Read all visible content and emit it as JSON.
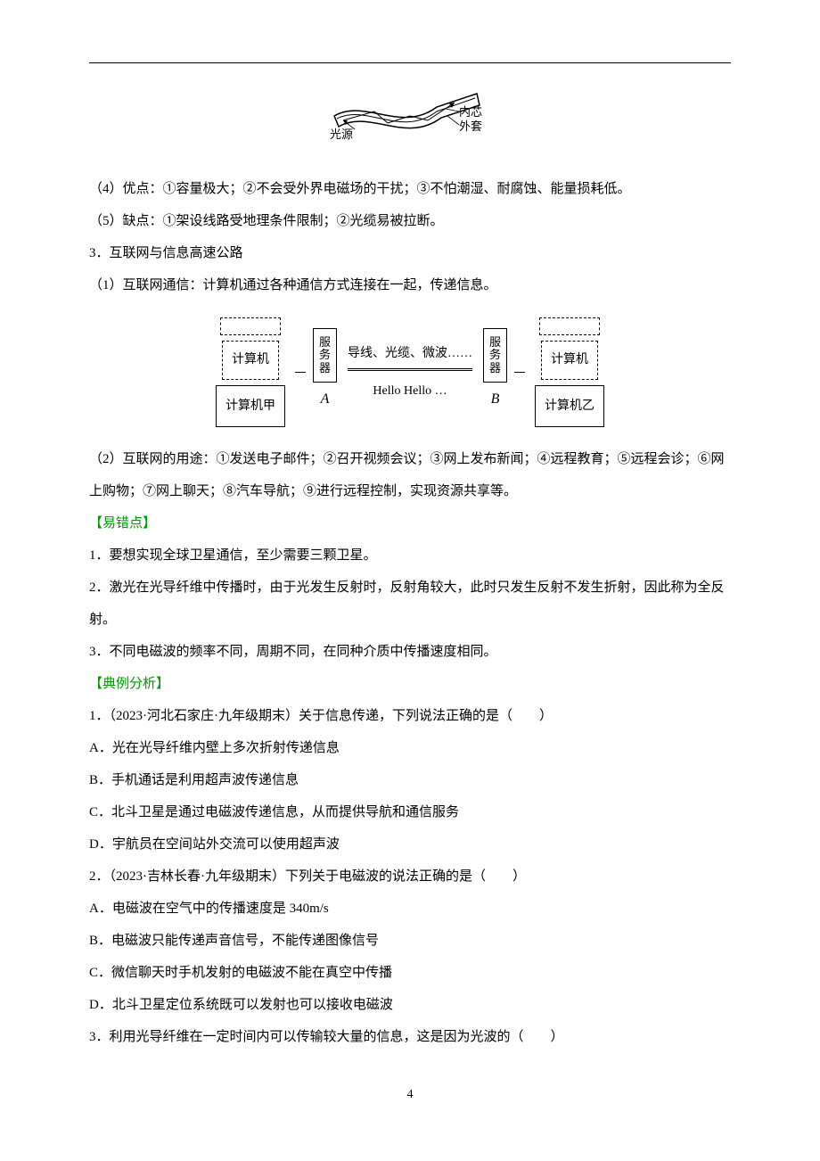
{
  "figure1": {
    "left_label": "光源",
    "right_label_top": "内芯",
    "right_label_bottom": "外套"
  },
  "para4": "（4）优点：①容量极大；②不会受外界电磁场的干扰；③不怕潮湿、耐腐蚀、能量损耗低。",
  "para5": "（5）缺点：①架设线路受地理条件限制；②光缆易被拉断。",
  "head3": "3．互联网与信息高速公路",
  "para3_1": "（1）互联网通信：计算机通过各种通信方式连接在一起，传递信息。",
  "diagram": {
    "computer_left": "计算机",
    "server_a": "服务器",
    "server_a_label": "A",
    "medium": "导线、光缆、微波……",
    "hello": "Hello Hello …",
    "server_b": "服务器",
    "server_b_label": "B",
    "computer_right": "计算机",
    "computer_jia": "计算机甲",
    "computer_yi": "计算机乙"
  },
  "para3_2": "（2）互联网的用途：①发送电子邮件；②召开视频会议；③网上发布新闻；④远程教育；⑤远程会诊；⑥网上购物；⑦网上聊天；⑧汽车导航；⑨进行远程控制，实现资源共享等。",
  "section_err": "【易错点】",
  "err1": "1．要想实现全球卫星通信，至少需要三颗卫星。",
  "err2": "2．激光在光导纤维中传播时，由于光发生反射时，反射角较大，此时只发生反射不发生折射，因此称为全反射。",
  "err3": "3．不同电磁波的频率不同，周期不同，在同种介质中传播速度相同。",
  "section_ex": "【典例分析】",
  "q1": "1．（2023·河北石家庄·九年级期末）关于信息传递，下列说法正确的是（　　）",
  "q1a": "A．光在光导纤维内壁上多次折射传递信息",
  "q1b": "B．手机通话是利用超声波传递信息",
  "q1c": "C．北斗卫星是通过电磁波传递信息，从而提供导航和通信服务",
  "q1d": "D．宇航员在空间站外交流可以使用超声波",
  "q2": "2．（2023·吉林长春·九年级期末）下列关于电磁波的说法正确的是（　　）",
  "q2a": "A．电磁波在空气中的传播速度是 340m/s",
  "q2b": "B．电磁波只能传递声音信号，不能传递图像信号",
  "q2c": "C．微信聊天时手机发射的电磁波不能在真空中传播",
  "q2d": "D．北斗卫星定位系统既可以发射也可以接收电磁波",
  "q3": "3．利用光导纤维在一定时间内可以传输较大量的信息，这是因为光波的（　　）",
  "page_number": "4"
}
